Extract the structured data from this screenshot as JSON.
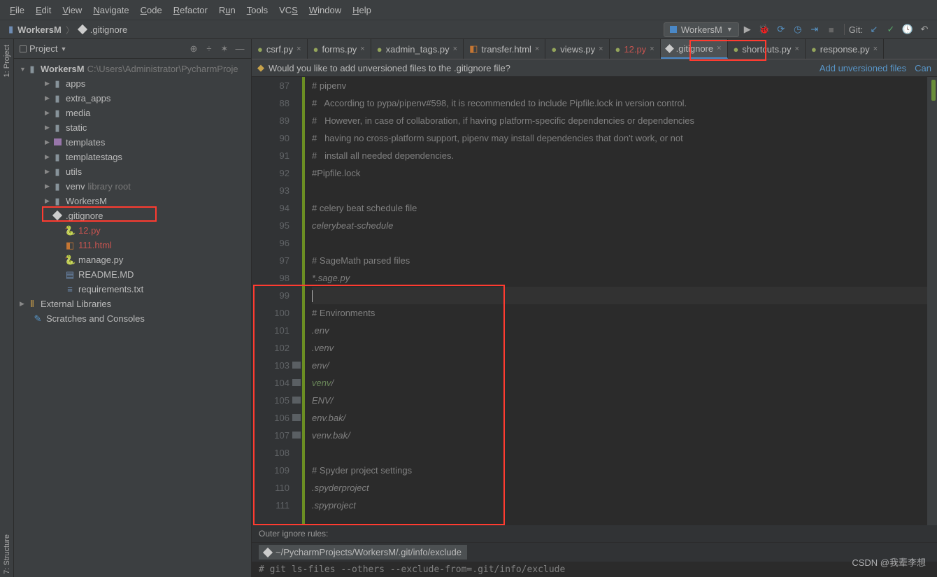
{
  "menu": {
    "file": "File",
    "edit": "Edit",
    "view": "View",
    "navigate": "Navigate",
    "code": "Code",
    "refactor": "Refactor",
    "run": "Run",
    "tools": "Tools",
    "vcs": "VCS",
    "window": "Window",
    "help": "Help"
  },
  "nav": {
    "project": "WorkersM",
    "file": ".gitignore",
    "runconfig": "WorkersM ",
    "git_label": "Git:"
  },
  "sidebar": {
    "title": "Project",
    "root": "WorkersM",
    "root_path": "C:\\Users\\Administrator\\PycharmProje",
    "items": [
      {
        "kind": "dir",
        "name": "apps",
        "depth": 2
      },
      {
        "kind": "dir",
        "name": "extra_apps",
        "depth": 2
      },
      {
        "kind": "dir",
        "name": "media",
        "depth": 2
      },
      {
        "kind": "dir",
        "name": "static",
        "depth": 2
      },
      {
        "kind": "pkg",
        "name": "templates",
        "depth": 2
      },
      {
        "kind": "dir",
        "name": "templatestags",
        "depth": 2
      },
      {
        "kind": "dir",
        "name": "utils",
        "depth": 2
      },
      {
        "kind": "dir",
        "name": "venv",
        "meta": "library root",
        "depth": 2
      },
      {
        "kind": "dir",
        "name": "WorkersM",
        "depth": 2
      },
      {
        "kind": "git",
        "name": ".gitignore",
        "depth": 2,
        "hl": true
      },
      {
        "kind": "py",
        "name": "12.py",
        "depth": 3,
        "red": true
      },
      {
        "kind": "html",
        "name": "111.html",
        "depth": 3,
        "red": true
      },
      {
        "kind": "py",
        "name": "manage.py",
        "depth": 3
      },
      {
        "kind": "md",
        "name": "README.MD",
        "depth": 3
      },
      {
        "kind": "txt",
        "name": "requirements.txt",
        "depth": 3
      }
    ],
    "ext_lib": "External Libraries",
    "scratches": "Scratches and Consoles"
  },
  "leftstrip": {
    "project": "1: Project",
    "structure": "7: Structure"
  },
  "tabs": [
    {
      "icon": "py",
      "label": "csrf.py"
    },
    {
      "icon": "py",
      "label": "forms.py"
    },
    {
      "icon": "py",
      "label": "xadmin_tags.py"
    },
    {
      "icon": "html",
      "label": "transfer.html"
    },
    {
      "icon": "py",
      "label": "views.py"
    },
    {
      "icon": "py",
      "label": "12.py",
      "red": true
    },
    {
      "icon": "git",
      "label": ".gitignore",
      "active": true
    },
    {
      "icon": "py",
      "label": "shortcuts.py"
    },
    {
      "icon": "py",
      "label": "response.py"
    }
  ],
  "notice": {
    "msg": "Would you like to add unversioned files to the .gitignore file?",
    "link": "Add unversioned files",
    "cancel": "Can"
  },
  "code": {
    "start": 87,
    "lines": [
      {
        "t": "# pipenv",
        "c": "c"
      },
      {
        "t": "#   According to pypa/pipenv#598, it is recommended to include Pipfile.lock in version control.",
        "c": "c"
      },
      {
        "t": "#   However, in case of collaboration, if having platform-specific dependencies or dependencies",
        "c": "c"
      },
      {
        "t": "#   having no cross-platform support, pipenv may install dependencies that don't work, or not",
        "c": "c"
      },
      {
        "t": "#   install all needed dependencies.",
        "c": "c"
      },
      {
        "t": "#Pipfile.lock",
        "c": "c"
      },
      {
        "t": "",
        "c": "b"
      },
      {
        "t": "# celery beat schedule file",
        "c": "c"
      },
      {
        "t": "celerybeat-schedule",
        "c": "i"
      },
      {
        "t": "",
        "c": "b"
      },
      {
        "t": "# SageMath parsed files",
        "c": "c"
      },
      {
        "t": "*.sage.py",
        "c": "i"
      },
      {
        "t": "",
        "c": "caret"
      },
      {
        "t": "# Environments",
        "c": "c"
      },
      {
        "t": ".env",
        "c": "i"
      },
      {
        "t": ".venv",
        "c": "i"
      },
      {
        "t": "env/",
        "c": "i",
        "mark": true
      },
      {
        "t": "venv/",
        "c": "venv",
        "mark": true
      },
      {
        "t": "ENV/",
        "c": "i",
        "mark": true
      },
      {
        "t": "env.bak/",
        "c": "i",
        "mark": true
      },
      {
        "t": "venv.bak/",
        "c": "i",
        "mark": true
      },
      {
        "t": "",
        "c": "b"
      },
      {
        "t": "# Spyder project settings",
        "c": "c"
      },
      {
        "t": ".spyderproject",
        "c": "i"
      },
      {
        "t": ".spyproject",
        "c": "i"
      }
    ]
  },
  "outer": "Outer ignore rules:",
  "exclude": "~/PycharmProjects/WorkersM/.git/info/exclude",
  "bottom": "# git ls-files --others --exclude-from=.git/info/exclude",
  "watermark": "CSDN @我辈李想"
}
